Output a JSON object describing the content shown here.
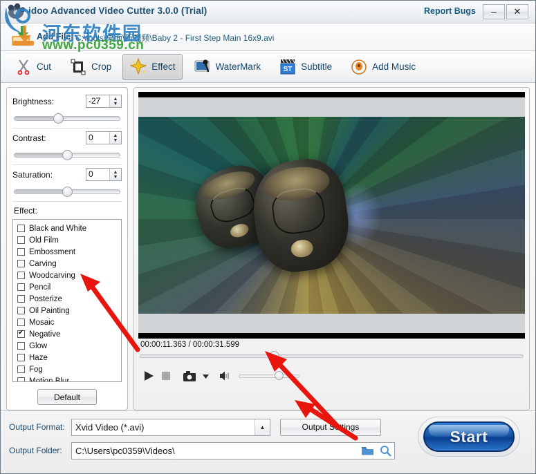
{
  "window": {
    "title": "idoo Advanced Video Cutter 3.0.0 (Trial)",
    "report_bugs": "Report Bugs",
    "minimize": "–",
    "close": "✕"
  },
  "filebar": {
    "add_file_label": "Add File",
    "file_path": "C:\\tools\\桌面\\新视频\\Baby 2 - First Step Main 16x9.avi"
  },
  "toolbar": {
    "items": [
      {
        "label": "Cut",
        "icon": "scissors-icon",
        "active": false
      },
      {
        "label": "Crop",
        "icon": "crop-icon",
        "active": false
      },
      {
        "label": "Effect",
        "icon": "sparkle-icon",
        "active": true
      },
      {
        "label": "WaterMark",
        "icon": "watermark-icon",
        "active": false
      },
      {
        "label": "Subtitle",
        "icon": "clapperboard-icon",
        "active": false
      },
      {
        "label": "Add Music",
        "icon": "speaker-icon",
        "active": false
      }
    ]
  },
  "adjustments": [
    {
      "label": "Brightness:",
      "value": "-27",
      "thumb_pct": 42
    },
    {
      "label": "Contrast:",
      "value": "0",
      "thumb_pct": 50
    },
    {
      "label": "Saturation:",
      "value": "0",
      "thumb_pct": 50
    }
  ],
  "effects": {
    "label": "Effect:",
    "items": [
      {
        "label": "Black and White",
        "checked": false
      },
      {
        "label": "Old Film",
        "checked": false
      },
      {
        "label": "Embossment",
        "checked": false
      },
      {
        "label": "Carving",
        "checked": false
      },
      {
        "label": "Woodcarving",
        "checked": false
      },
      {
        "label": "Pencil",
        "checked": false
      },
      {
        "label": "Posterize",
        "checked": false
      },
      {
        "label": "Oil Painting",
        "checked": false
      },
      {
        "label": "Mosaic",
        "checked": false
      },
      {
        "label": "Negative",
        "checked": true
      },
      {
        "label": "Glow",
        "checked": false
      },
      {
        "label": "Haze",
        "checked": false
      },
      {
        "label": "Fog",
        "checked": false
      },
      {
        "label": "Motion Blur",
        "checked": false
      }
    ],
    "default_button": "Default"
  },
  "player": {
    "current_time": "00:00:11.363",
    "total_time": "00:00:31.599",
    "timecode": "00:00:11.363 / 00:00:31.599",
    "seek_pct": 35,
    "volume_pct": 66,
    "controls": [
      "play-icon",
      "stop-icon",
      "snapshot-icon",
      "snapshot-dropdown-icon",
      "volume-icon"
    ]
  },
  "output": {
    "format_label": "Output Format:",
    "format_value": "Xvid Video (*.avi)",
    "folder_label": "Output Folder:",
    "folder_value": "C:\\Users\\pc0359\\Videos\\",
    "settings_button": "Output Settings",
    "start_button": "Start"
  },
  "watermark": {
    "site_cn": "河东软件园",
    "site_url": "www.pc0359.cn"
  },
  "colors": {
    "accent_blue": "#14476b",
    "start_blue": "#1456a8",
    "arrow_red": "#e8150f",
    "watermark_blue": "#2f7fc1",
    "watermark_green": "#3aa33a"
  }
}
